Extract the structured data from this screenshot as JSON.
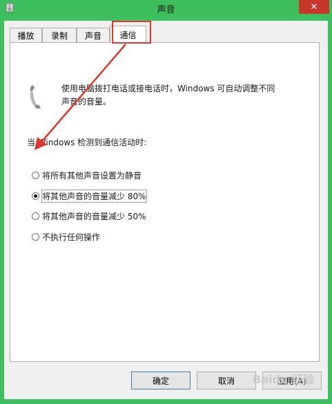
{
  "window": {
    "title": "声音",
    "close_glyph": "✕",
    "app_icon": "speaker-icon"
  },
  "tabs": [
    {
      "label": "播放",
      "active": false
    },
    {
      "label": "录制",
      "active": false
    },
    {
      "label": "声音",
      "active": false
    },
    {
      "label": "通信",
      "active": true
    }
  ],
  "communications": {
    "description_line1": "使用电脑拨打电话或接电话时，Windows 可自动调整不同",
    "description_line2": "声音的音量。",
    "section_label": "当 Windows 检测到通信活动时:",
    "options": [
      {
        "label": "将所有其他声音设置为静音",
        "checked": false
      },
      {
        "label": "将其他声音的音量减少 80%",
        "checked": true
      },
      {
        "label": "将其他声音的音量减少 50%",
        "checked": false
      },
      {
        "label": "不执行任何操作",
        "checked": false
      }
    ]
  },
  "buttons": {
    "ok": "确定",
    "cancel": "取消",
    "apply": "应用(A)"
  },
  "watermark": "Baidu 经验",
  "colors": {
    "titlebar": "#3dbf5d",
    "close": "#c7352b",
    "annotation": "#e0352b"
  }
}
